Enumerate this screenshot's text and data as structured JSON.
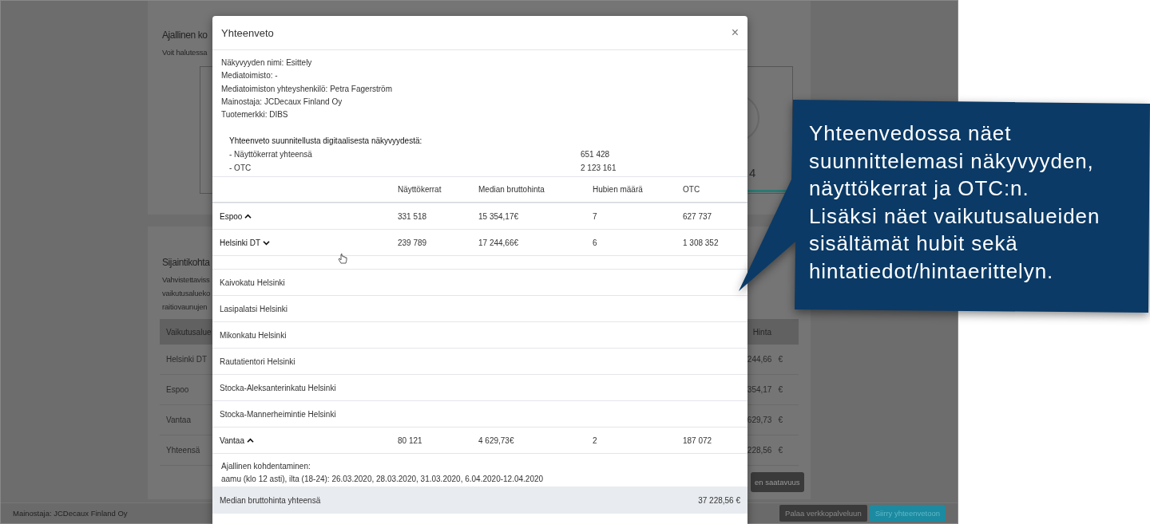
{
  "page": {
    "time_section": {
      "title": "Ajallinen ko",
      "lines": [
        "Voit halutessa"
      ],
      "fragment": "4"
    },
    "location_section": {
      "title": "Sijaintikohta",
      "lines": [
        "Vahvistettaviss",
        "vaikutusalueko",
        "raitiovaunujen"
      ],
      "table": {
        "columns": [
          "Vaikutusalue",
          "Hinta"
        ],
        "rows": [
          {
            "column_1": "Helsinki DT",
            "price": "244,66",
            "currency": "€"
          },
          {
            "column_1": "Espoo",
            "price": "354,17",
            "currency": "€"
          },
          {
            "column_1": "Vantaa",
            "price": "629,73",
            "currency": "€"
          },
          {
            "column_1": "Yhteensä",
            "price": "228,56",
            "currency": "€"
          }
        ]
      },
      "button": "en saatavuus"
    },
    "footer": {
      "advertiser": "Mainostaja: JCDecaux Finland Oy",
      "buttons": [
        {
          "label": "Palaa verkkopalveluun",
          "kind": "secondary"
        },
        {
          "label": "Siirry yhteenvetoon",
          "kind": "primary"
        }
      ]
    }
  },
  "modal": {
    "title": "Yhteenveto",
    "close": "×",
    "info": [
      "Näkyvyyden nimi: Esittely",
      "Mediatoimisto: -",
      "Mediatoimiston yhteyshenkilö: Petra Fagerström",
      "Mainostaja: JCDecaux Finland Oy",
      "Tuotemerkki: DIBS"
    ],
    "summary": {
      "title": "Yhteenveto suunnitellusta digitaalisesta näkyvyydestä:",
      "rows": [
        {
          "label": "- Näyttökerrat yhteensä",
          "value": "651 428"
        },
        {
          "label": "- OTC",
          "value": "2 123 161"
        }
      ]
    },
    "table": {
      "columns": [
        "Näyttökerrat",
        "Median bruttohinta",
        "Hubien määrä",
        "OTC"
      ],
      "rows": [
        {
          "name": "Espoo",
          "expanded": false,
          "impressions": "331 518",
          "price": "15 354,17€",
          "hubs": "7",
          "otc": "627 737"
        },
        {
          "name": "Helsinki DT",
          "expanded": true,
          "impressions": "239 789",
          "price": "17 244,66€",
          "hubs": "6",
          "otc": "1 308 352",
          "children": [
            {
              "name": "Kaivokatu Helsinki"
            },
            {
              "name": "Lasipalatsi Helsinki"
            },
            {
              "name": "Mikonkatu Helsinki"
            },
            {
              "name": "Rautatientori Helsinki"
            },
            {
              "name": "Stocka-Aleksanterinkatu Helsinki"
            },
            {
              "name": "Stocka-Mannerheimintie Helsinki"
            }
          ]
        },
        {
          "name": "Vantaa",
          "expanded": false,
          "impressions": "80 121",
          "price": "4 629,73€",
          "hubs": "2",
          "otc": "187 072"
        }
      ]
    },
    "time_targeting": {
      "title": "Ajallinen kohdentaminen:",
      "text": "aamu (klo 12 asti), ilta (18-24): 26.03.2020, 28.03.2020, 31.03.2020, 6.04.2020-12.04.2020"
    },
    "total": {
      "label": "Median bruttohinta yhteensä",
      "value": "37 228,56 €"
    }
  },
  "callout": {
    "lines": [
      "Yhteenvedossa näet",
      "suunnittelemasi näkyvyyden,",
      "näyttökerrat ja OTC:n.",
      "Lisäksi näet vaikutusalueiden",
      "sisältämät hubit sekä",
      "hintatiedot/hintaerittelyn."
    ]
  }
}
